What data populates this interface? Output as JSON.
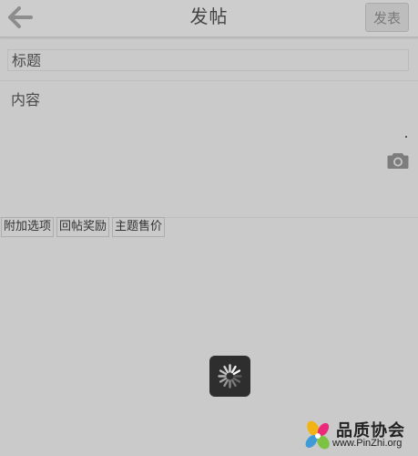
{
  "header": {
    "back_icon": "arrow-left-icon",
    "title": "发帖",
    "submit_label": "发表"
  },
  "form": {
    "subject_placeholder": "标题",
    "content_placeholder": "内容",
    "camera_icon": "camera-icon"
  },
  "tabs": [
    {
      "label": "附加选项"
    },
    {
      "label": "回帖奖励"
    },
    {
      "label": "主题售价"
    }
  ],
  "loading": {
    "icon": "spinner-icon"
  },
  "watermark": {
    "title": "品质协会",
    "url": "www.PinZhi.org"
  },
  "colors": {
    "background": "#c8c8c8",
    "header_bg": "#cdcdcd",
    "spinner_bg": "#2e2e2e",
    "icon_gray": "#8d8d8d"
  }
}
